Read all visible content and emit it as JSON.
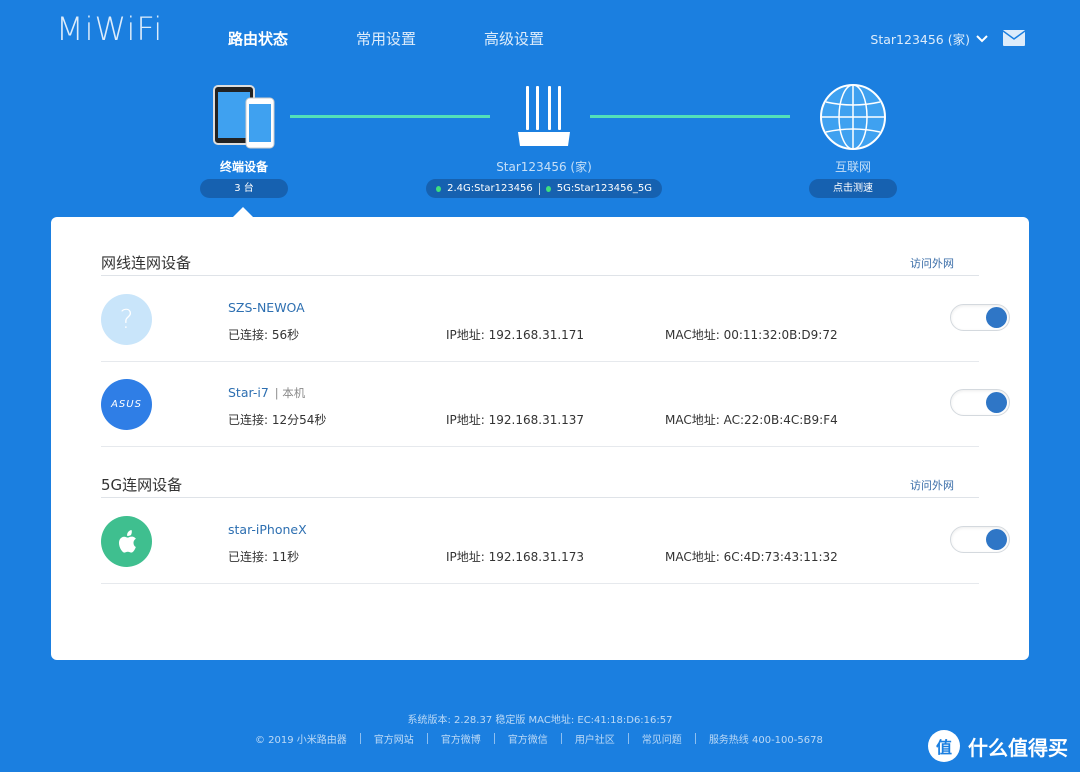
{
  "header": {
    "logo": "MiWiFi",
    "nav": [
      "路由状态",
      "常用设置",
      "高级设置"
    ],
    "user": "Star123456 (家)"
  },
  "topology": {
    "devices": {
      "label": "终端设备",
      "count": "3 台"
    },
    "router": {
      "name": "Star123456 (家)",
      "wifi_24": "2.4G:Star123456",
      "wifi_5": "5G:Star123456_5G"
    },
    "internet": {
      "label": "互联网",
      "action": "点击测速"
    }
  },
  "sections": [
    {
      "title": "网线连网设备",
      "link": "访问外网",
      "devices": [
        {
          "name": "SZS-NEWOA",
          "tag": "",
          "connected": "已连接: 56秒",
          "ip": "IP地址: 192.168.31.171",
          "mac": "MAC地址: 00:11:32:0B:D9:72",
          "icon": "question-icon",
          "access": true
        },
        {
          "name": "Star-i7",
          "tag": "| 本机",
          "connected": "已连接: 12分54秒",
          "ip": "IP地址: 192.168.31.137",
          "mac": "MAC地址: AC:22:0B:4C:B9:F4",
          "icon": "asus-logo-icon",
          "icon_text": "ASUS",
          "access": true
        }
      ]
    },
    {
      "title": "5G连网设备",
      "link": "访问外网",
      "devices": [
        {
          "name": "star-iPhoneX",
          "tag": "",
          "connected": "已连接: 11秒",
          "ip": "IP地址: 192.168.31.173",
          "mac": "MAC地址: 6C:4D:73:43:11:32",
          "icon": "apple-icon",
          "access": true
        }
      ]
    }
  ],
  "footer": {
    "version": "系统版本: 2.28.37 稳定版  MAC地址: EC:41:18:D6:16:57",
    "links": [
      "© 2019 小米路由器",
      "官方网站",
      "官方微博",
      "官方微信",
      "用户社区",
      "常见问题",
      "服务热线 400-100-5678"
    ]
  },
  "watermark": {
    "badge": "值",
    "text": "什么值得买"
  },
  "colors": {
    "background": "#1b7fe0",
    "accent": "#2f76c6",
    "link_line": "#53e0b8",
    "status_dot": "#3ee07d"
  }
}
